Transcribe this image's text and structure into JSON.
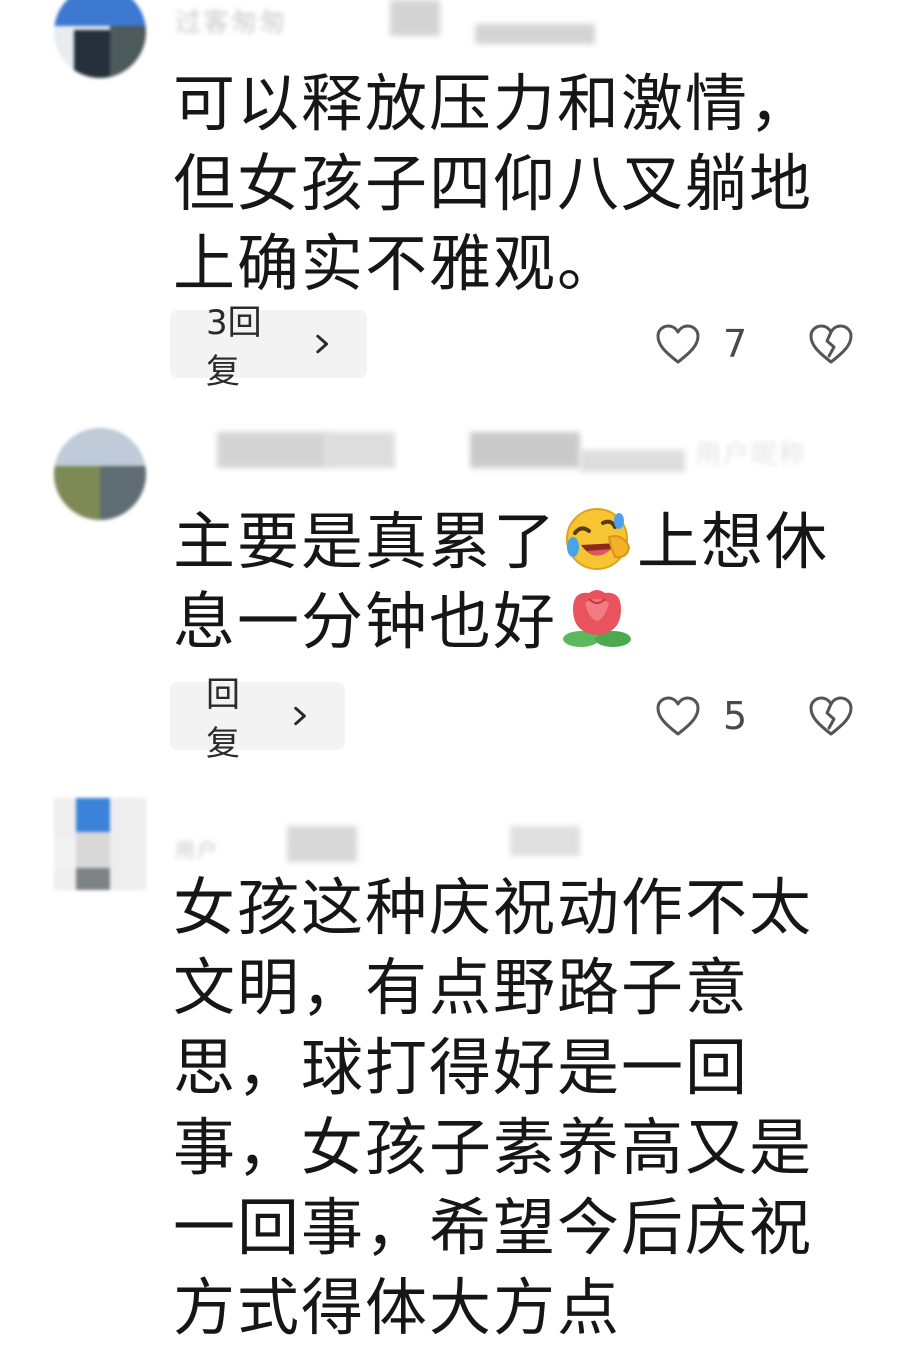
{
  "comments": [
    {
      "username": "过客匆匆",
      "text": "可以释放压力和激情，但女孩子四仰八叉躺地上确实不雅观。",
      "reply_label": "3回复",
      "like_count": "7",
      "icons": {
        "reply": "chevron-right-icon",
        "like": "heart-outline-icon",
        "dislike": "broken-heart-icon"
      }
    },
    {
      "username": "用户昵称",
      "text_part1": "主要是真累了",
      "text_part2": "上想休息一分钟也好",
      "emojis": [
        "rolling-on-floor-laughing-emoji",
        "rose-flower-emoji"
      ],
      "reply_label": "回复",
      "like_count": "5",
      "icons": {
        "reply": "chevron-right-icon",
        "like": "heart-outline-icon",
        "dislike": "broken-heart-icon"
      }
    },
    {
      "username": "用户",
      "text": "女孩这种庆祝动作不太文明，有点野路子意思，球打得好是一回事，女孩子素养高又是一回事，希望今后庆祝方式得体大方点"
    }
  ],
  "colors": {
    "text": "#161616",
    "pill_background": "#f3f3f3",
    "icon": "#555555",
    "count": "#4a4a4a"
  }
}
